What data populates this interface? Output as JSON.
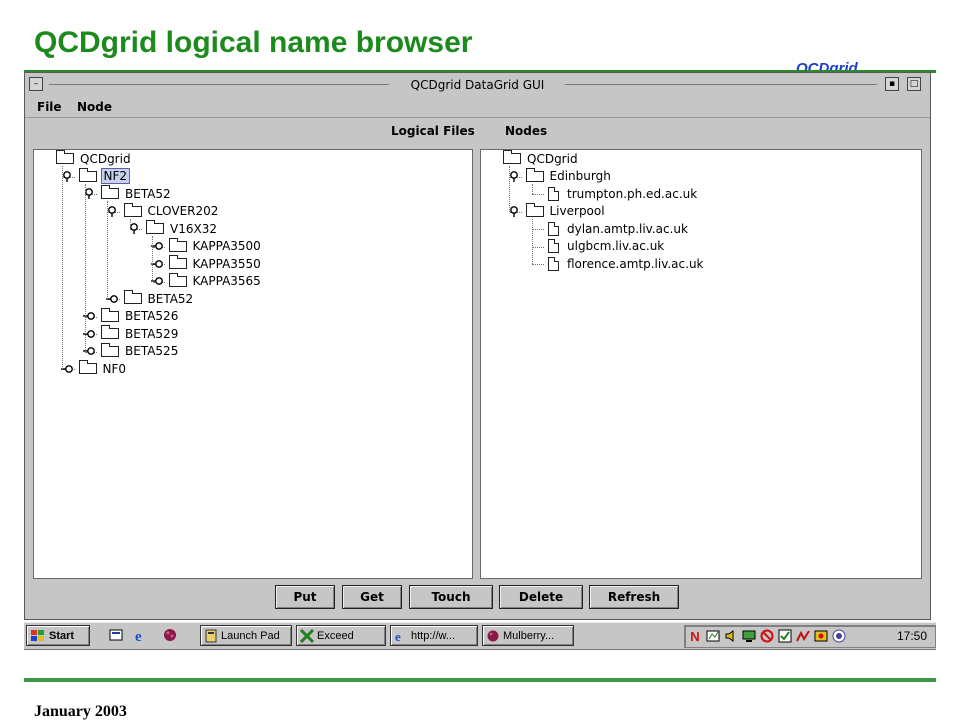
{
  "slide": {
    "title": "QCDgrid logical name browser",
    "logo": "QCDgrid",
    "footer": "January 2003"
  },
  "window": {
    "title": "QCDgrid DataGrid GUI",
    "menu": [
      "File",
      "Node"
    ],
    "headers": {
      "left": "Logical Files",
      "right": "Nodes"
    },
    "buttons": [
      "Put",
      "Get",
      "Touch",
      "Delete",
      "Refresh"
    ]
  },
  "logical_tree": [
    {
      "label": "QCDgrid",
      "type": "folder",
      "depth": 0,
      "toggle": "none"
    },
    {
      "label": "NF2",
      "type": "folder",
      "depth": 1,
      "toggle": "expanded",
      "selected": true
    },
    {
      "label": "BETA52",
      "type": "folder",
      "depth": 2,
      "toggle": "expanded"
    },
    {
      "label": "CLOVER202",
      "type": "folder",
      "depth": 3,
      "toggle": "expanded"
    },
    {
      "label": "V16X32",
      "type": "folder",
      "depth": 4,
      "toggle": "expanded"
    },
    {
      "label": "KAPPA3500",
      "type": "folder",
      "depth": 5,
      "toggle": "collapsed"
    },
    {
      "label": "KAPPA3550",
      "type": "folder",
      "depth": 5,
      "toggle": "collapsed"
    },
    {
      "label": "KAPPA3565",
      "type": "folder",
      "depth": 5,
      "toggle": "collapsed"
    },
    {
      "label": "BETA52",
      "type": "folder",
      "depth": 3,
      "toggle": "collapsed"
    },
    {
      "label": "BETA526",
      "type": "folder",
      "depth": 2,
      "toggle": "collapsed"
    },
    {
      "label": "BETA529",
      "type": "folder",
      "depth": 2,
      "toggle": "collapsed"
    },
    {
      "label": "BETA525",
      "type": "folder",
      "depth": 2,
      "toggle": "collapsed"
    },
    {
      "label": "NF0",
      "type": "folder",
      "depth": 1,
      "toggle": "collapsed"
    }
  ],
  "nodes_tree": [
    {
      "label": "QCDgrid",
      "type": "folder",
      "depth": 0,
      "toggle": "none"
    },
    {
      "label": "Edinburgh",
      "type": "folder",
      "depth": 1,
      "toggle": "expanded"
    },
    {
      "label": "trumpton.ph.ed.ac.uk",
      "type": "file",
      "depth": 2,
      "toggle": "none"
    },
    {
      "label": "Liverpool",
      "type": "folder",
      "depth": 1,
      "toggle": "expanded"
    },
    {
      "label": "dylan.amtp.liv.ac.uk",
      "type": "file",
      "depth": 2,
      "toggle": "none"
    },
    {
      "label": "ulgbcm.liv.ac.uk",
      "type": "file",
      "depth": 2,
      "toggle": "none"
    },
    {
      "label": "florence.amtp.liv.ac.uk",
      "type": "file",
      "depth": 2,
      "toggle": "none"
    }
  ],
  "taskbar": {
    "start": "Start",
    "tasks": [
      "Launch Pad",
      "Exceed",
      "http://w...",
      "Mulberry..."
    ],
    "clock": "17:50"
  },
  "colors": {
    "title_green": "#1c8a1c",
    "logo_blue": "#1a3ccc",
    "window_gray": "#c6c6c6"
  }
}
